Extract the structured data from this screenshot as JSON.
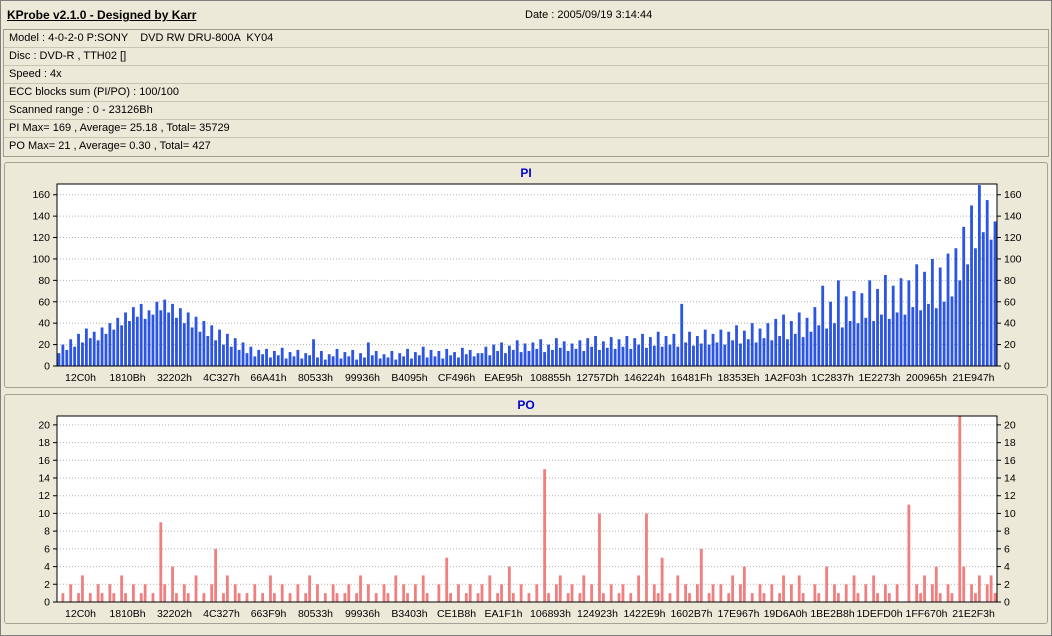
{
  "window": {
    "title": "KProbe v2.1.0 - Designed by Karr",
    "date_label": "Date : 2005/09/19 3:14:44"
  },
  "info_panel": {
    "lines": [
      "Model : 4-0-2-0 P:SONY    DVD RW DRU-800A  KY04",
      "Disc : DVD-R , TTH02 []",
      "Speed : 4x",
      "ECC blocks sum (PI/PO) : 100/100",
      "Scanned range : 0 - 23126Bh",
      "PI Max= 169 , Average= 25.18 , Total= 35729",
      "PO Max= 21 , Average= 0.30 , Total= 427"
    ]
  },
  "chart_data": [
    {
      "type": "bar",
      "title": "PI",
      "color": "#2c55e2",
      "ylim": [
        0,
        170
      ],
      "ytick_step": 20,
      "grid": true,
      "stats": {
        "max": 169,
        "average": 25.18,
        "total": 35729
      },
      "x_labels": [
        "12C0h",
        "1810Bh",
        "32202h",
        "4C327h",
        "66A41h",
        "80533h",
        "99936h",
        "B4095h",
        "CF496h",
        "EAE95h",
        "108855h",
        "12757Dh",
        "146224h",
        "16481Fh",
        "18353Eh",
        "1A2F03h",
        "1C2837h",
        "1E2273h",
        "200965h",
        "21E947h"
      ],
      "values": [
        12,
        20,
        15,
        25,
        18,
        30,
        22,
        35,
        26,
        32,
        24,
        36,
        30,
        40,
        34,
        45,
        38,
        50,
        42,
        55,
        46,
        58,
        44,
        52,
        48,
        60,
        52,
        62,
        50,
        58,
        45,
        54,
        40,
        50,
        36,
        46,
        32,
        42,
        28,
        38,
        24,
        34,
        20,
        30,
        18,
        26,
        15,
        22,
        12,
        18,
        9,
        15,
        11,
        16,
        8,
        14,
        10,
        17,
        7,
        13,
        9,
        15,
        7,
        12,
        10,
        25,
        8,
        14,
        6,
        11,
        9,
        16,
        7,
        13,
        9,
        15,
        6,
        12,
        8,
        22,
        10,
        14,
        7,
        11,
        8,
        14,
        6,
        12,
        9,
        16,
        7,
        13,
        10,
        18,
        8,
        15,
        9,
        14,
        7,
        16,
        10,
        13,
        8,
        17,
        11,
        15,
        9,
        12,
        12,
        18,
        10,
        20,
        14,
        22,
        12,
        19,
        15,
        24,
        13,
        21,
        14,
        22,
        16,
        25,
        13,
        20,
        15,
        26,
        17,
        23,
        14,
        21,
        16,
        24,
        14,
        26,
        18,
        28,
        15,
        23,
        17,
        27,
        16,
        25,
        18,
        28,
        16,
        26,
        20,
        30,
        17,
        27,
        19,
        32,
        18,
        28,
        20,
        30,
        18,
        58,
        22,
        32,
        19,
        28,
        21,
        34,
        20,
        30,
        22,
        34,
        20,
        32,
        24,
        38,
        21,
        33,
        25,
        40,
        22,
        35,
        26,
        40,
        24,
        44,
        28,
        48,
        25,
        42,
        30,
        50,
        27,
        45,
        32,
        55,
        38,
        75,
        35,
        60,
        40,
        80,
        36,
        65,
        42,
        70,
        40,
        68,
        45,
        80,
        42,
        72,
        48,
        85,
        44,
        75,
        50,
        82,
        48,
        80,
        55,
        95,
        52,
        88,
        58,
        100,
        54,
        92,
        60,
        105,
        65,
        110,
        80,
        130,
        95,
        150,
        110,
        169,
        125,
        155,
        118,
        135
      ]
    },
    {
      "type": "bar",
      "title": "PO",
      "color": "#f08080",
      "ylim": [
        0,
        21
      ],
      "ytick_step": 2,
      "grid": true,
      "stats": {
        "max": 21,
        "average": 0.3,
        "total": 427
      },
      "x_labels": [
        "12C0h",
        "1810Bh",
        "32202h",
        "4C327h",
        "663F9h",
        "80533h",
        "99936h",
        "B3403h",
        "CE1B8h",
        "EA1F1h",
        "106893h",
        "124923h",
        "1422E9h",
        "1602B7h",
        "17E967h",
        "19D6A0h",
        "1BE2B8h",
        "1DEFD0h",
        "1FF670h",
        "21E2F3h"
      ],
      "values": [
        0,
        1,
        0,
        2,
        0,
        1,
        3,
        0,
        1,
        0,
        2,
        1,
        0,
        2,
        1,
        0,
        3,
        1,
        0,
        2,
        0,
        1,
        2,
        0,
        1,
        0,
        9,
        2,
        0,
        4,
        1,
        0,
        2,
        1,
        0,
        3,
        0,
        1,
        0,
        2,
        6,
        0,
        1,
        3,
        0,
        2,
        1,
        0,
        1,
        0,
        2,
        0,
        1,
        0,
        3,
        1,
        0,
        2,
        0,
        1,
        0,
        2,
        0,
        1,
        3,
        0,
        2,
        0,
        1,
        0,
        2,
        1,
        0,
        1,
        2,
        0,
        1,
        3,
        0,
        2,
        0,
        1,
        0,
        2,
        1,
        0,
        3,
        0,
        2,
        1,
        0,
        2,
        0,
        3,
        1,
        0,
        0,
        2,
        0,
        5,
        1,
        0,
        2,
        0,
        1,
        2,
        0,
        1,
        2,
        0,
        3,
        0,
        1,
        2,
        0,
        4,
        1,
        0,
        2,
        0,
        1,
        0,
        2,
        0,
        15,
        1,
        0,
        2,
        3,
        0,
        1,
        2,
        0,
        1,
        3,
        0,
        2,
        0,
        10,
        1,
        0,
        2,
        0,
        1,
        2,
        0,
        1,
        0,
        3,
        0,
        10,
        0,
        2,
        1,
        5,
        0,
        1,
        0,
        3,
        0,
        2,
        1,
        0,
        2,
        6,
        0,
        1,
        2,
        0,
        2,
        0,
        1,
        3,
        0,
        2,
        4,
        0,
        1,
        0,
        2,
        1,
        0,
        2,
        0,
        1,
        3,
        0,
        2,
        0,
        3,
        1,
        0,
        0,
        2,
        1,
        0,
        4,
        0,
        2,
        1,
        0,
        2,
        0,
        3,
        1,
        0,
        2,
        0,
        3,
        1,
        0,
        2,
        1,
        0,
        2,
        0,
        0,
        11,
        0,
        2,
        1,
        3,
        0,
        2,
        4,
        1,
        0,
        2,
        1,
        0,
        21,
        4,
        0,
        2,
        1,
        3,
        0,
        2,
        3,
        1
      ]
    }
  ]
}
